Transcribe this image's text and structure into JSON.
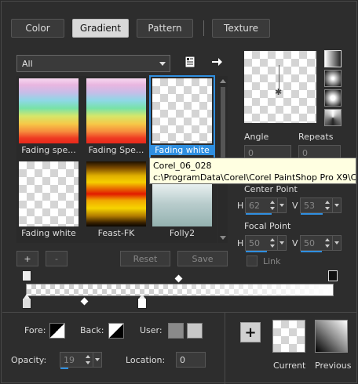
{
  "tabs": [
    "Color",
    "Gradient",
    "Pattern",
    "Texture"
  ],
  "active_tab": "Gradient",
  "category": {
    "selected": "All"
  },
  "gradients": [
    {
      "label": "Fading spe...",
      "selected": false
    },
    {
      "label": "Fading Spe...",
      "selected": false
    },
    {
      "label": "Fading white",
      "selected": true
    },
    {
      "label": "Fading white",
      "selected": false
    },
    {
      "label": "Feast-FK",
      "selected": false
    },
    {
      "label": "Folly2",
      "selected": false
    }
  ],
  "tooltip": {
    "line1": "Corel_06_028",
    "line2": "c:\\ProgramData\\Corel\\Corel PaintShop Pro X9\\C"
  },
  "buttons": {
    "add": "+",
    "remove": "-",
    "reset": "Reset",
    "save": "Save"
  },
  "settings": {
    "angle_label": "Angle",
    "angle_value": "0",
    "repeats_label": "Repeats",
    "repeats_value": "0",
    "center_point_label": "Center Point",
    "center_h_label": "H",
    "center_h": "62",
    "center_v_label": "V",
    "center_v": "53",
    "focal_point_label": "Focal Point",
    "focal_h_label": "H",
    "focal_h": "50",
    "focal_v_label": "V",
    "focal_v": "50",
    "link_label": "Link"
  },
  "bottom": {
    "fore_label": "Fore:",
    "back_label": "Back:",
    "user_label": "User:",
    "opacity_label": "Opacity:",
    "opacity_value": "19",
    "location_label": "Location:",
    "location_value": "0",
    "current_label": "Current",
    "previous_label": "Previous",
    "add_label": "+"
  },
  "colors": {
    "accent": "#2f8fe0",
    "tooltip_bg": "#ffffe1",
    "user_color_1": "#8a8a8a",
    "user_color_2": "#c8c8c8"
  },
  "icons": [
    "library-icon",
    "arrow-right-icon",
    "linear-style-icon",
    "rectangular-style-icon",
    "sunburst-style-icon",
    "radial-style-icon"
  ]
}
